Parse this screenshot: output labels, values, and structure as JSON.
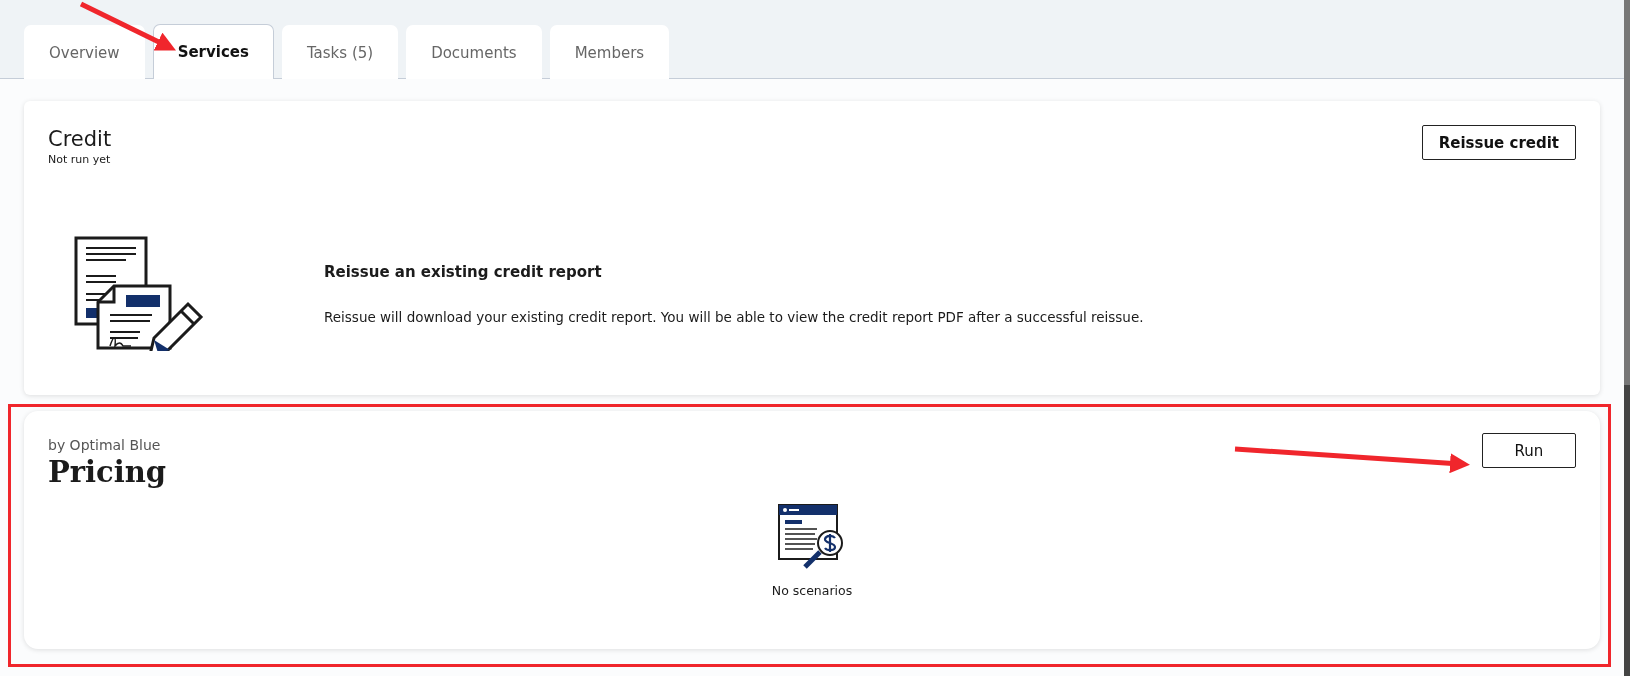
{
  "tabs": [
    {
      "label": "Overview",
      "selected": false
    },
    {
      "label": "Services",
      "selected": true
    },
    {
      "label": "Tasks (5)",
      "selected": false
    },
    {
      "label": "Documents",
      "selected": false
    },
    {
      "label": "Members",
      "selected": false
    }
  ],
  "credit": {
    "title": "Credit",
    "status": "Not run yet",
    "button": "Reissue credit",
    "heading": "Reissue an existing credit report",
    "description": "Reissue will download your existing credit report. You will be able to view the credit report PDF after a successful reissue."
  },
  "pricing": {
    "provider": "by Optimal Blue",
    "title": "Pricing",
    "button": "Run",
    "empty_message": "No scenarios"
  }
}
